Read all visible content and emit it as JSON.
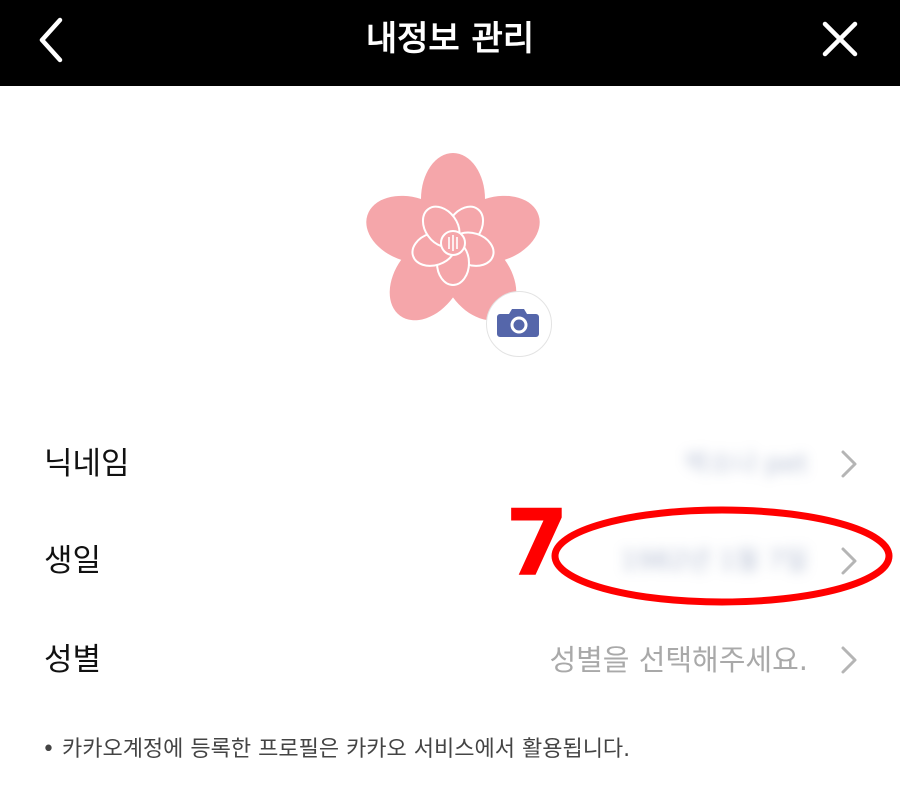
{
  "header": {
    "title": "내정보 관리",
    "back_icon": "chevron-left-icon",
    "close_icon": "close-icon"
  },
  "profile": {
    "avatar_icon": "cherry-blossom-icon",
    "camera_icon": "camera-icon",
    "camera_color": "#5566aa",
    "flower_color": "#f5a6aa"
  },
  "rows": [
    {
      "label": "닉네임",
      "value": "박소나 pet",
      "blurred": true
    },
    {
      "label": "생일",
      "value": "1982년 1월 7일",
      "blurred": true
    },
    {
      "label": "성별",
      "value": "성별을 선택해주세요.",
      "blurred": false
    }
  ],
  "annotation": {
    "number": "7",
    "color": "#ff0000"
  },
  "footnote": "• 카카오계정에 등록한 프로필은 카카오 서비스에서 활용됩니다."
}
